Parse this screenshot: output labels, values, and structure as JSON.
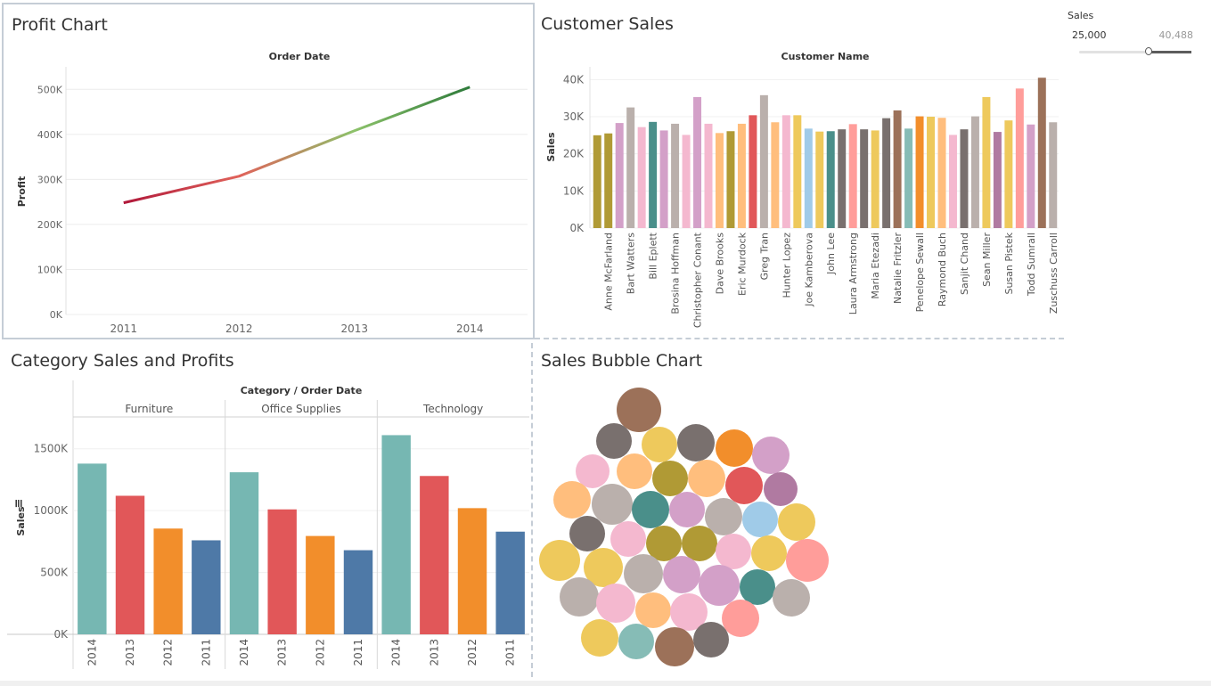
{
  "profit_chart": {
    "title": "Profit Chart",
    "chart_data": {
      "type": "line",
      "title": "Order Date",
      "ylabel": "Profit",
      "x": [
        "2011",
        "2012",
        "2013",
        "2014"
      ],
      "y": [
        248000,
        307000,
        408000,
        505000
      ],
      "ylim": [
        0,
        550000
      ],
      "yticks": [
        0,
        100000,
        200000,
        300000,
        400000,
        500000
      ],
      "ytick_labels": [
        "0K",
        "100K",
        "200K",
        "300K",
        "400K",
        "500K"
      ],
      "color_gradient": [
        "#b0183a",
        "#e0625a",
        "#8cc26a",
        "#2d7a3a"
      ],
      "grid": true
    }
  },
  "customer_sales": {
    "title": "Customer Sales",
    "chart_data": {
      "type": "bar",
      "title": "Customer Name",
      "ylabel": "Sales",
      "categories": [
        "",
        "Anne McFarland",
        "",
        "Bart Watters",
        "",
        "Bill Eplett",
        "",
        "Brosina Hoffman",
        "",
        "Christopher Conant",
        "",
        "Dave Brooks",
        "",
        "Eric Murdock",
        "",
        "Greg Tran",
        "",
        "Hunter Lopez",
        "",
        "Joe Kamberova",
        "",
        "John Lee",
        "",
        "Laura Armstrong",
        "",
        "Maria Etezadi",
        "",
        "Natalie Fritzler",
        "",
        "Penelope Sewall",
        "",
        "Raymond Buch",
        "",
        "Sanjit Chand",
        "",
        "Sean Miller",
        "",
        "Susan Pistek",
        "",
        "Todd Sumrall",
        "",
        "Zuschuss Carroll"
      ],
      "values": [
        25000,
        25500,
        28300,
        32500,
        27200,
        28600,
        26300,
        28100,
        25100,
        35300,
        28100,
        25600,
        26100,
        28100,
        30400,
        35800,
        28500,
        30400,
        30400,
        26800,
        26000,
        26100,
        26600,
        28000,
        26600,
        26300,
        29600,
        31700,
        26800,
        30100,
        30000,
        29700,
        25100,
        26600,
        30100,
        35300,
        25900,
        29000,
        37600,
        27900,
        40500,
        28500
      ],
      "colors": [
        "#b09a35",
        "#b09a35",
        "#d3a0c8",
        "#bab0ac",
        "#f4b8cf",
        "#4a8f8a",
        "#d3a0c8",
        "#bab0ac",
        "#f4b8cf",
        "#d3a0c8",
        "#f4b8cf",
        "#ffbe7d",
        "#b09a35",
        "#ffbe7d",
        "#e15759",
        "#bab0ac",
        "#ffbe7d",
        "#f4b8cf",
        "#eec95c",
        "#a0cbe8",
        "#eec95c",
        "#4a8f8a",
        "#79706e",
        "#ff9d9a",
        "#79706e",
        "#eec95c",
        "#79706e",
        "#9c7159",
        "#86bcb6",
        "#f28e2b",
        "#eec95c",
        "#ffbe7d",
        "#f4b8cf",
        "#79706e",
        "#bab0ac",
        "#eec95c",
        "#b07aa1",
        "#eec95c",
        "#ff9d9a",
        "#d3a0c8",
        "#9c7159",
        "#bab0ac"
      ],
      "ylim": [
        0,
        42000
      ],
      "yticks": [
        0,
        10000,
        20000,
        30000,
        40000
      ],
      "ytick_labels": [
        "0K",
        "10K",
        "20K",
        "30K",
        "40K"
      ]
    }
  },
  "sales_filter": {
    "title": "Sales",
    "min_label": "25,000",
    "max_label": "40,488",
    "handle_value": 25000,
    "range_min": 0,
    "range_max": 40488
  },
  "category_sales": {
    "title": "Category Sales and Profits",
    "chart_data": {
      "type": "bar",
      "title": "Category / Order Date",
      "ylabel": "Sales",
      "groups": [
        "Furniture",
        "Office Supplies",
        "Technology"
      ],
      "categories": [
        "2014",
        "2013",
        "2012",
        "2011"
      ],
      "series": [
        {
          "group": "Furniture",
          "values": [
            1380000,
            1120000,
            855000,
            760000
          ]
        },
        {
          "group": "Office Supplies",
          "values": [
            1310000,
            1010000,
            795000,
            680000
          ]
        },
        {
          "group": "Technology",
          "values": [
            1610000,
            1280000,
            1020000,
            830000
          ]
        }
      ],
      "year_colors": [
        "#76b7b2",
        "#e15759",
        "#f28e2b",
        "#4e79a7"
      ],
      "ylim": [
        0,
        1750000
      ],
      "yticks": [
        0,
        500000,
        1000000,
        1500000
      ],
      "ytick_labels": [
        "0K",
        "500K",
        "1000K",
        "1500K"
      ]
    }
  },
  "bubble_chart": {
    "title": "Sales Bubble Chart",
    "bubble_colors": [
      "#9c7159",
      "#79706e",
      "#eec95c",
      "#79706e",
      "#f28e2b",
      "#d3a0c8",
      "#f4b8cf",
      "#ffbe7d",
      "#b09a35",
      "#ffbe7d",
      "#e15759",
      "#b07aa1",
      "#ffbe7d",
      "#bab0ac",
      "#4a8f8a",
      "#d3a0c8",
      "#bab0ac",
      "#a0cbe8",
      "#eec95c",
      "#79706e",
      "#f4b8cf",
      "#b09a35",
      "#b09a35",
      "#f4b8cf",
      "#eec95c",
      "#ff9d9a",
      "#eec95c",
      "#eec95c",
      "#bab0ac",
      "#d3a0c8",
      "#d3a0c8",
      "#4a8f8a",
      "#bab0ac",
      "#bab0ac",
      "#f4b8cf",
      "#ffbe7d",
      "#f4b8cf",
      "#ff9d9a",
      "#eec95c",
      "#86bcb6",
      "#9c7159",
      "#79706e"
    ]
  }
}
